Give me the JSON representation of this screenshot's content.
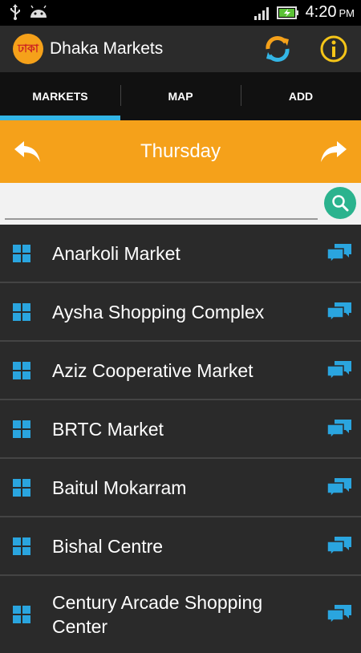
{
  "status_bar": {
    "icons": [
      "usb-icon",
      "android-icon",
      "signal-icon",
      "battery-charging-icon"
    ],
    "time": "4:20",
    "ampm": "PM"
  },
  "action_bar": {
    "logo_text": "ঢাকা",
    "title": "Dhaka Markets",
    "refresh_icon": "refresh-icon",
    "info_icon": "info-icon"
  },
  "tabs": [
    {
      "label": "MARKETS",
      "active": true
    },
    {
      "label": "MAP",
      "active": false
    },
    {
      "label": "ADD",
      "active": false
    }
  ],
  "day_nav": {
    "title": "Thursday",
    "prev_icon": "back-arrow-icon",
    "next_icon": "forward-arrow-icon"
  },
  "search": {
    "value": "",
    "placeholder": "",
    "button_icon": "search-icon"
  },
  "markets": [
    {
      "name": "Anarkoli Market"
    },
    {
      "name": "Aysha Shopping Complex"
    },
    {
      "name": "Aziz Cooperative Market"
    },
    {
      "name": "BRTC Market"
    },
    {
      "name": "Baitul Mokarram"
    },
    {
      "name": "Bishal Centre"
    },
    {
      "name": "Century Arcade Shopping Center"
    }
  ],
  "colors": {
    "accent_orange": "#f5a11a",
    "tab_indicator": "#33b5e5",
    "icon_blue": "#2aa5df",
    "search_green": "#2bb38e",
    "info_yellow": "#f5c518"
  }
}
